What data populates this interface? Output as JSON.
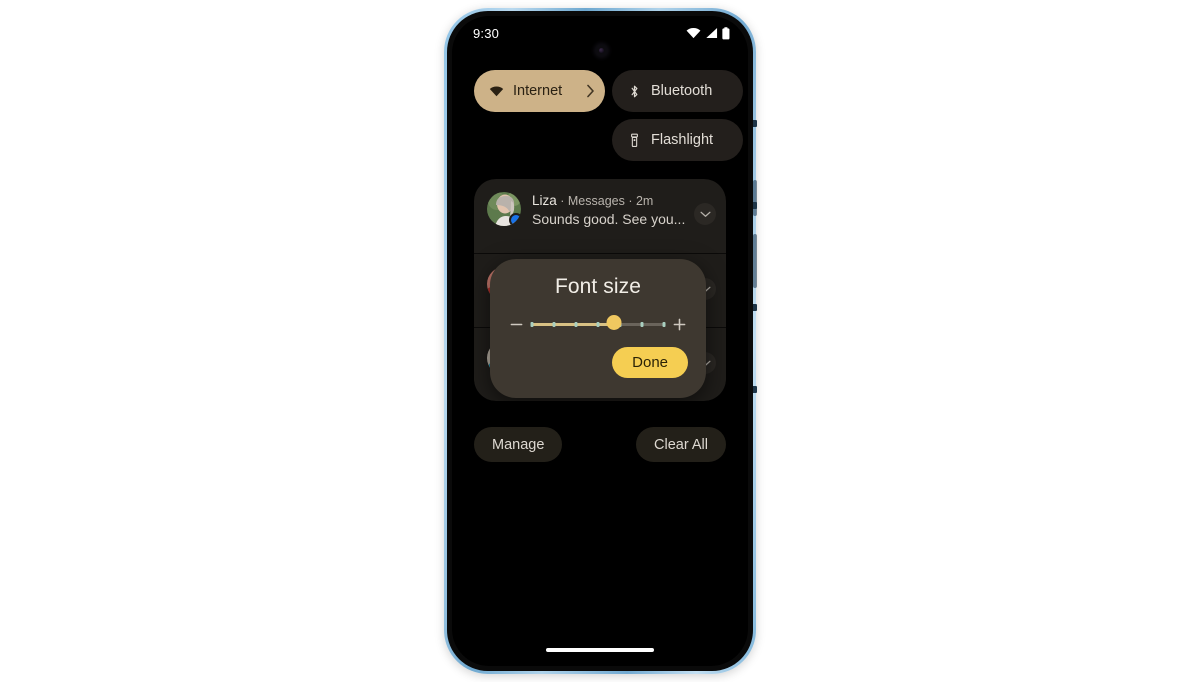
{
  "status_bar": {
    "clock": "9:30",
    "icons": [
      "wifi-icon",
      "cell-signal-icon",
      "battery-icon"
    ]
  },
  "quick_settings": {
    "tiles": [
      {
        "label": "Internet",
        "icon": "wifi-icon",
        "state": "on",
        "has_chevron": true,
        "bg": "#cdb288",
        "fg": "#2a2113"
      },
      {
        "label": "Bluetooth",
        "icon": "bluetooth-icon",
        "state": "off",
        "has_chevron": false,
        "bg": "#231f1c",
        "fg": "#e2ddd6"
      },
      {
        "label": "Flashlight",
        "icon": "flashlight-icon",
        "state": "off",
        "has_chevron": false,
        "bg": "#231f1c",
        "fg": "#e2ddd6"
      }
    ]
  },
  "notifications": [
    {
      "sender": "Liza",
      "meta": " · Messages · 2m",
      "app": "Messages",
      "time": "2m",
      "text": "Sounds good. See you...",
      "badge_color": "#1a73e8",
      "avatar_colors": [
        "#6f8a5a",
        "#c8b9a8"
      ],
      "expand_icon": "chevron-down-icon"
    },
    {
      "sender": "",
      "meta": "",
      "app": "",
      "time": "",
      "text": "",
      "badge_color": "#b23a2c",
      "avatar_colors": [
        "#c2766a",
        "#b0302a"
      ],
      "expand_icon": "chevron-down-icon"
    },
    {
      "sender": "",
      "meta": "",
      "app": "",
      "time": "",
      "text": "",
      "badge_color": "#3d8fa8",
      "avatar_colors": [
        "#b8b0a4",
        "#2f8fa8"
      ],
      "expand_icon": "chevron-down-icon"
    }
  ],
  "shade_footer": {
    "manage_label": "Manage",
    "clear_label": "Clear All"
  },
  "dialog": {
    "title": "Font size",
    "done_label": "Done",
    "decrease_icon": "minus-icon",
    "increase_icon": "plus-icon",
    "slider": {
      "steps": 7,
      "value": 5,
      "min": 1,
      "max": 7,
      "percent": 62,
      "fill_color": "#d8c184",
      "track_color": "#6a645b",
      "thumb_color": "#f0c860",
      "tick_color": "#a8cfc0"
    },
    "bg": "#3e3830",
    "accent": "#f5ce52"
  },
  "gesture_bar": {
    "label": "home-gesture-bar"
  }
}
